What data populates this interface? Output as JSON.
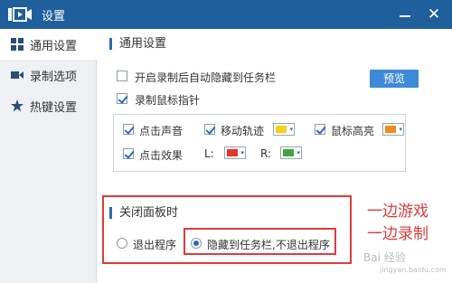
{
  "window": {
    "title": "设置",
    "title_color": "#1f5f9c"
  },
  "sidebar": {
    "items": [
      {
        "label": "通用设置",
        "icon": "sliders-icon",
        "active": true
      },
      {
        "label": "录制选项",
        "icon": "video-camera-icon",
        "active": false
      },
      {
        "label": "热键设置",
        "icon": "star-icon",
        "active": false
      }
    ]
  },
  "general": {
    "section_title": "通用设置",
    "auto_hide_label": "开启录制后自动隐藏到任务栏",
    "auto_hide_checked": false,
    "record_mouse_label": "录制鼠标指针",
    "record_mouse_checked": true,
    "preview_button": "预览",
    "mouse": {
      "click_sound_label": "点击声音",
      "click_sound_checked": true,
      "move_track_label": "移动轨迹",
      "move_track_checked": true,
      "move_track_color": "#f5d218",
      "highlight_label": "鼠标高亮",
      "highlight_checked": true,
      "highlight_color": "#f08a1c",
      "click_effect_label": "点击效果",
      "click_effect_checked": true,
      "left_label": "L:",
      "left_color": "#e8322e",
      "right_label": "R:",
      "right_color": "#3fa63f"
    }
  },
  "close_panel": {
    "section_title": "关闭面板时",
    "exit_label": "退出程序",
    "exit_selected": false,
    "hide_label": "隐藏到任务栏,不退出程序",
    "hide_selected": true
  },
  "annotation": {
    "line1": "一边游戏",
    "line2": "一边录制",
    "color": "#e03a3a"
  },
  "watermark": {
    "text": "Bai 经验",
    "sub": "jingyan.baidu.com"
  }
}
